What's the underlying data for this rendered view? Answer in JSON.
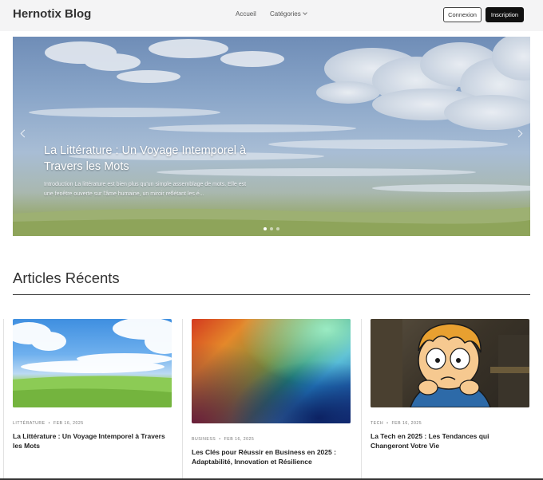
{
  "navbar": {
    "brand": "Hernotix Blog",
    "links": [
      "Accueil",
      "Catégories"
    ],
    "login_label": "Connexion",
    "signup_label": "Inscription"
  },
  "hero": {
    "title": "La Littérature : Un Voyage Intemporel à Travers les Mots",
    "excerpt": "Introduction  La littérature est bien plus qu'un simple assemblage de mots. Elle est une fenêtre ouverte sur l'âme humaine, un miroir reflétant les é...",
    "slide_count": 3,
    "active_slide": 1
  },
  "recent": {
    "heading": "Articles Récents",
    "articles": [
      {
        "category": "Littérature",
        "date": "Feb 16, 2025",
        "title": "La Littérature : Un Voyage Intemporel à Travers les Mots",
        "image": "anime-sky-landscape"
      },
      {
        "category": "Business",
        "date": "Feb 16, 2025",
        "title": "Les Clés pour Réussir en Business en 2025 : Adaptabilité, Innovation et Résilience",
        "image": "color-gradient"
      },
      {
        "category": "Tech",
        "date": "Feb 16, 2025",
        "title": "La Tech en 2025 : Les Tendances qui Changeront Votre Vie",
        "image": "cartoon-worried-man"
      }
    ]
  },
  "colors": {
    "primary": "#111111",
    "navbar_bg": "#f4f4f5",
    "text": "#222222"
  }
}
